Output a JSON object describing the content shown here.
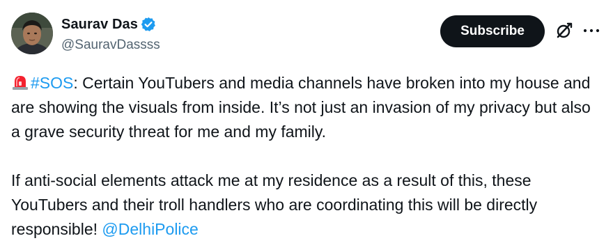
{
  "author": {
    "display_name": "Saurav Das",
    "handle": "@SauravDassss",
    "verified": true
  },
  "actions": {
    "subscribe_label": "Subscribe"
  },
  "icons": {
    "verified": "verified-badge-icon",
    "grok": "grok-icon",
    "more": "more-options-icon",
    "siren": "rotating-light-emoji"
  },
  "tweet": {
    "hashtag": "#SOS",
    "paragraph1_text": ": Certain YouTubers and media channels have broken into my house and are showing the visuals from inside. It’s not just an invasion of my privacy but also a grave security threat for me and my family.",
    "paragraph2_text": "If anti-social elements attack me at my residence as a result of this, these YouTubers and their troll handlers who are coordinating this will be directly responsible! ",
    "mention": "@DelhiPolice"
  },
  "colors": {
    "link": "#1d9bf0",
    "verified": "#1d9bf0",
    "text": "#0f1419",
    "secondary_text": "#536471",
    "button_bg": "#0f1419"
  }
}
